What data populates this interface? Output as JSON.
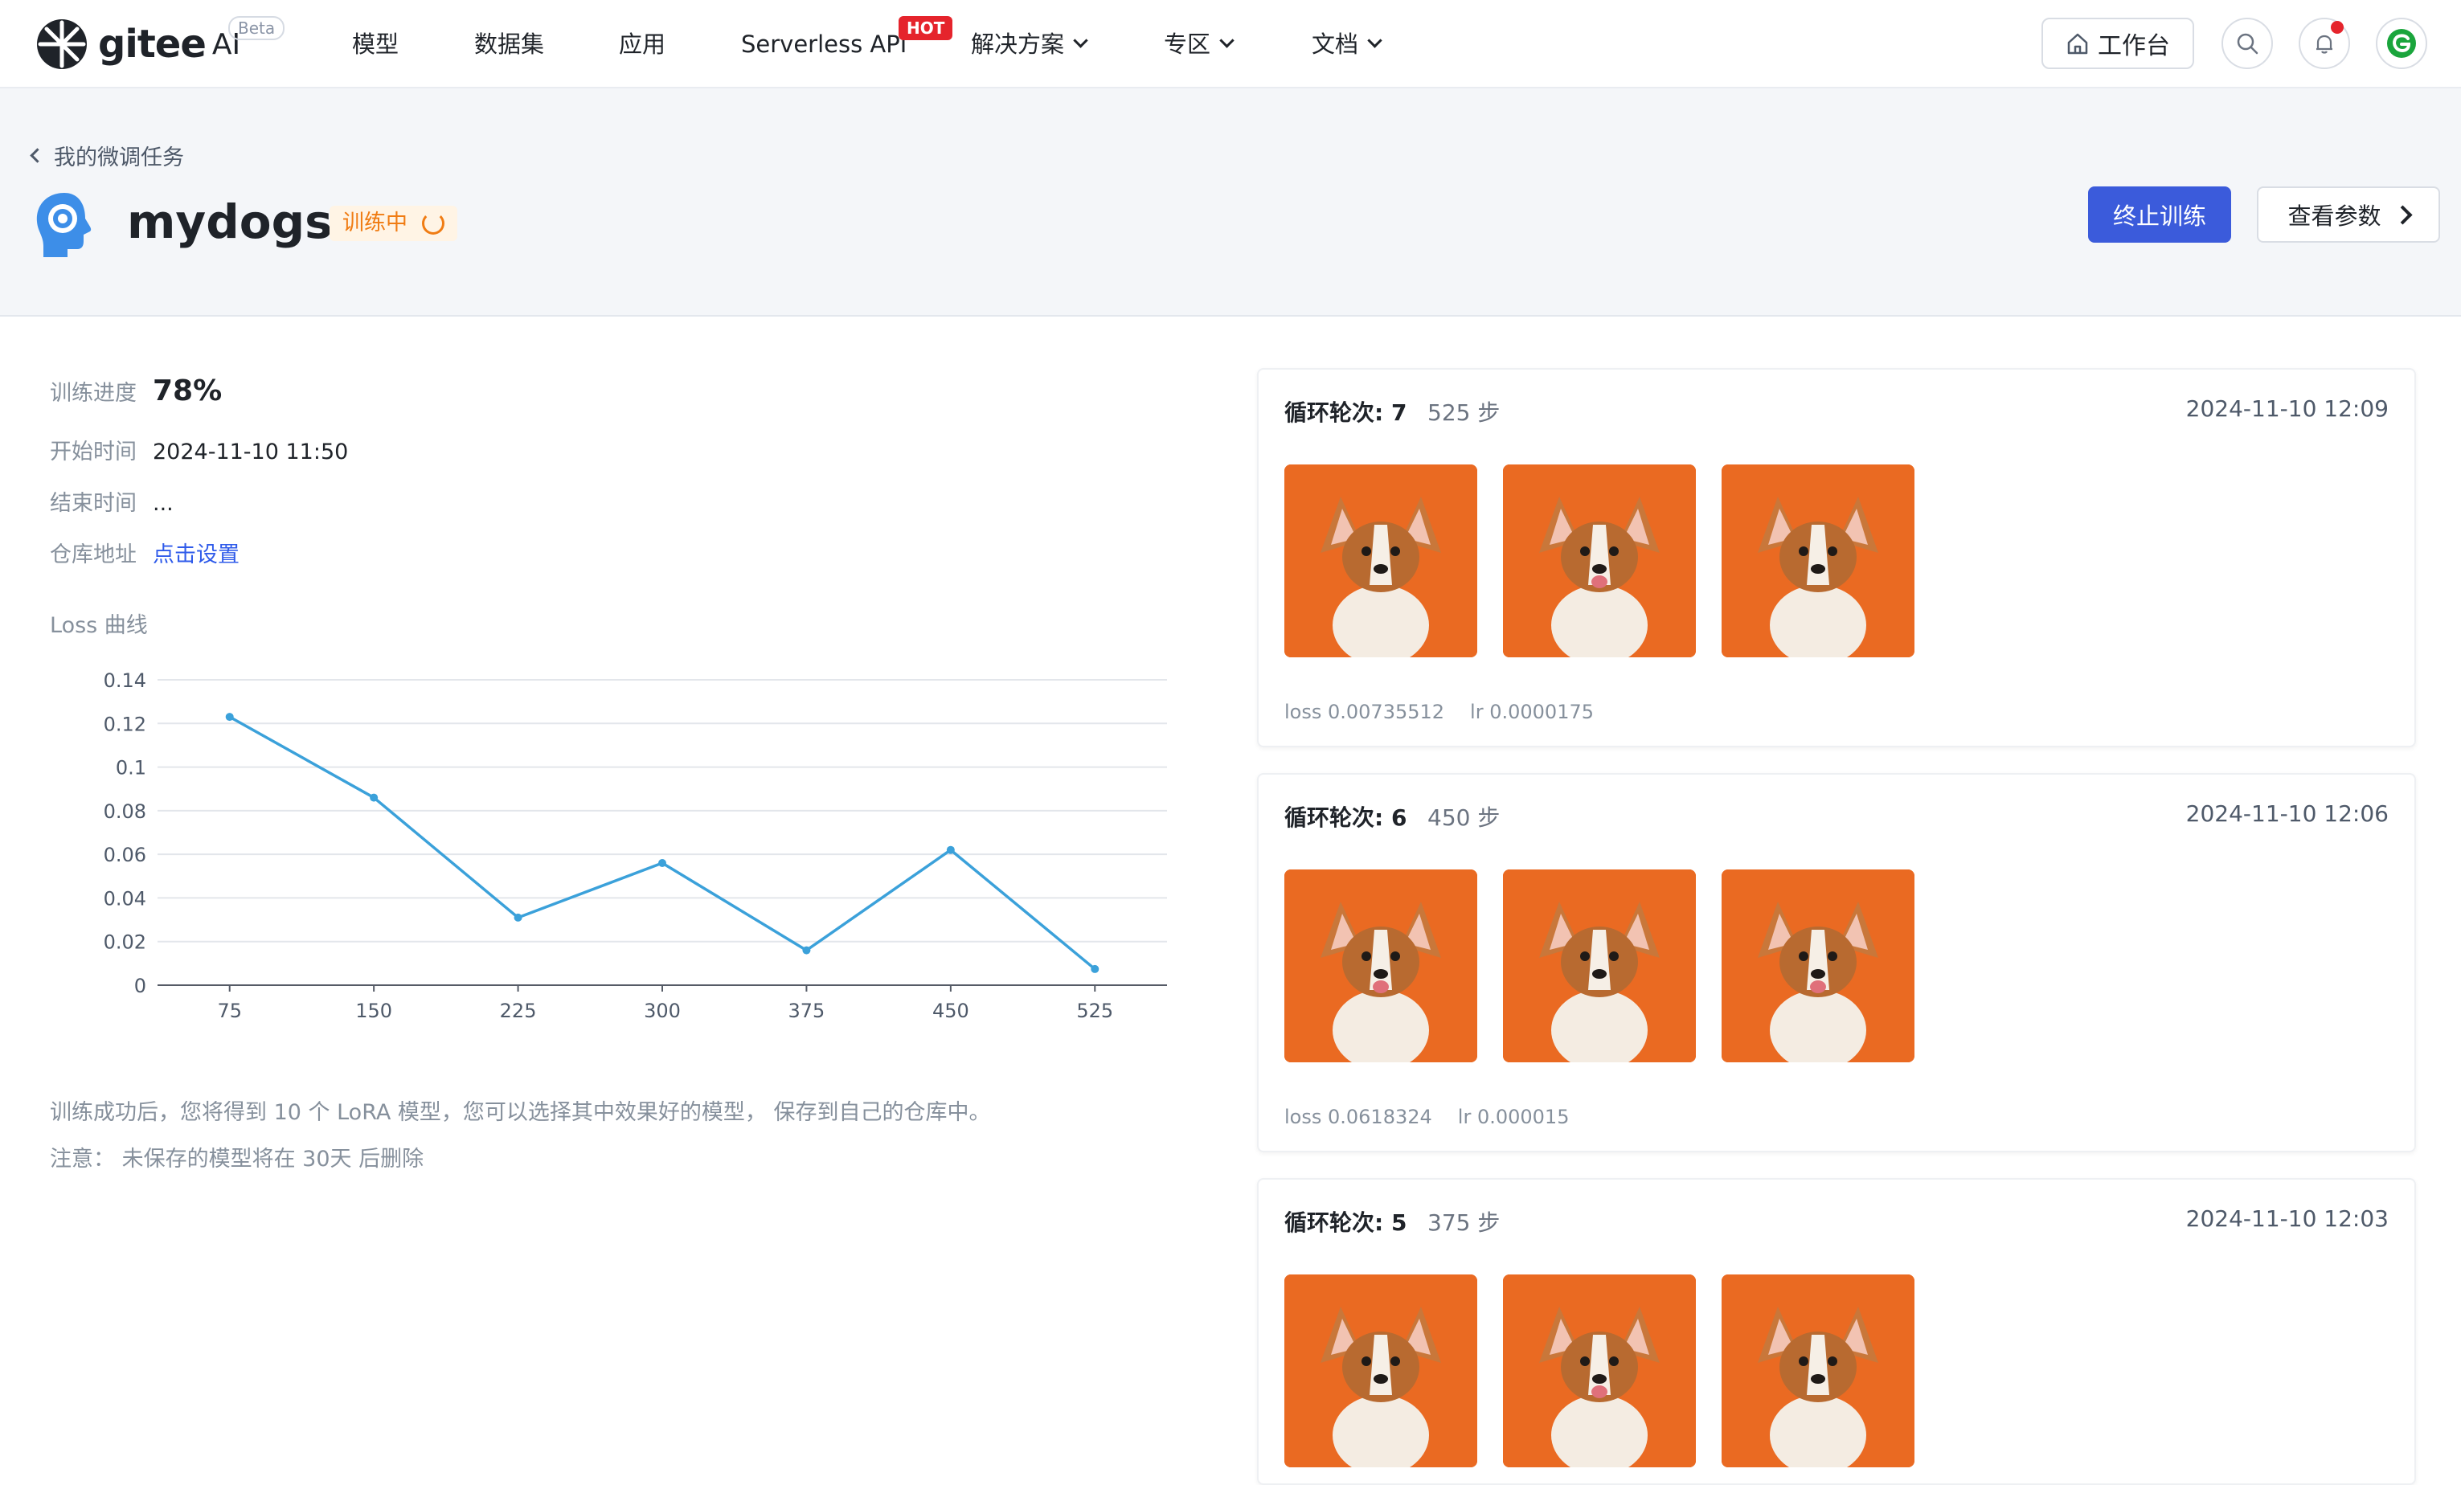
{
  "nav": {
    "logo_text": "gitee",
    "logo_ai": "AI",
    "beta": "Beta",
    "items": [
      {
        "label": "模型",
        "dropdown": false
      },
      {
        "label": "数据集",
        "dropdown": false
      },
      {
        "label": "应用",
        "dropdown": false
      },
      {
        "label": "Serverless API",
        "dropdown": false
      },
      {
        "label": "解决方案",
        "dropdown": true
      },
      {
        "label": "专区",
        "dropdown": true
      },
      {
        "label": "文档",
        "dropdown": true
      }
    ],
    "hot_badge": "HOT",
    "workbench": "工作台"
  },
  "header": {
    "back_label": "我的微调任务",
    "title": "mydogs",
    "status": "训练中",
    "stop_button": "终止训练",
    "params_button": "查看参数"
  },
  "info": {
    "progress_label": "训练进度",
    "progress_value": "78%",
    "start_label": "开始时间",
    "start_value": "2024-11-10 11:50",
    "end_label": "结束时间",
    "end_value": "...",
    "repo_label": "仓库地址",
    "repo_value": "点击设置"
  },
  "loss_title": "Loss 曲线",
  "chart_data": {
    "type": "line",
    "title": "",
    "xlabel": "",
    "ylabel": "",
    "x": [
      75,
      150,
      225,
      300,
      375,
      450,
      525
    ],
    "series": [
      {
        "values": [
          0.123,
          0.086,
          0.031,
          0.056,
          0.016,
          0.062,
          0.0074
        ]
      }
    ],
    "ylim": [
      0,
      0.14
    ],
    "yticks": [
      "0.14",
      "0.12",
      "0.1",
      "0.08",
      "0.06",
      "0.04",
      "0.02",
      "0"
    ],
    "xticks": [
      "75",
      "150",
      "225",
      "300",
      "375",
      "450",
      "525"
    ],
    "grid": true,
    "color": "#3ba1da"
  },
  "tips": {
    "line1": "训练成功后，您将得到 10 个 LoRA 模型，您可以选择其中效果好的模型， 保存到自己的仓库中。",
    "line2": "注意： 未保存的模型将在 30天 后删除"
  },
  "cards": [
    {
      "epoch": "循环轮次: 7",
      "steps": "525 步",
      "time": "2024-11-10 12:09",
      "loss": "loss 0.00735512",
      "lr": "lr 0.0000175"
    },
    {
      "epoch": "循环轮次: 6",
      "steps": "450 步",
      "time": "2024-11-10 12:06",
      "loss": "loss 0.0618324",
      "lr": "lr 0.000015"
    },
    {
      "epoch": "循环轮次: 5",
      "steps": "375 步",
      "time": "2024-11-10 12:03",
      "loss": "",
      "lr": ""
    }
  ],
  "colors": {
    "accent": "#3b5bdb",
    "status": "#f07c13",
    "link": "#2f5bea",
    "thumb_bg": "#ea6a22"
  }
}
